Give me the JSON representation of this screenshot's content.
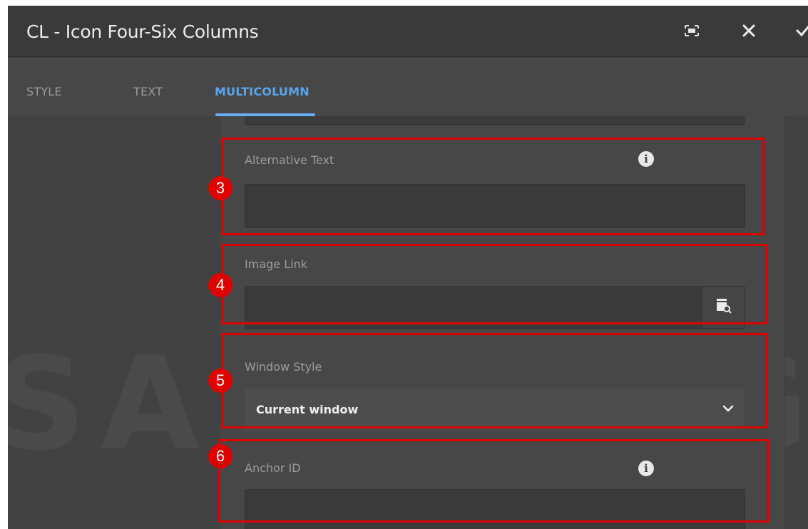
{
  "dialog": {
    "title": "CL - Icon Four-Six Columns",
    "actions": {
      "fullscreen_icon": "fullscreen-icon",
      "close_icon": "close-icon",
      "done_icon": "checkmark-icon"
    }
  },
  "tabs": [
    {
      "label": "STYLE",
      "active": false
    },
    {
      "label": "TEXT",
      "active": false
    },
    {
      "label": "MULTICOLUMN",
      "active": true
    }
  ],
  "background_watermark": "SAMSUNG",
  "fields": {
    "alternative_text": {
      "label": "Alternative Text",
      "value": "",
      "has_info": true
    },
    "image_link": {
      "label": "Image Link",
      "value": "",
      "browse_icon": "browse-path-icon"
    },
    "window_style": {
      "label": "Window Style",
      "selected": "Current window"
    },
    "anchor_id": {
      "label": "Anchor ID",
      "value": "",
      "has_info": true
    }
  },
  "annotations": [
    "3",
    "4",
    "5",
    "6"
  ],
  "colors": {
    "accent": "#6aaef0",
    "annotation": "#e10000",
    "background": "#3f3f3f"
  }
}
